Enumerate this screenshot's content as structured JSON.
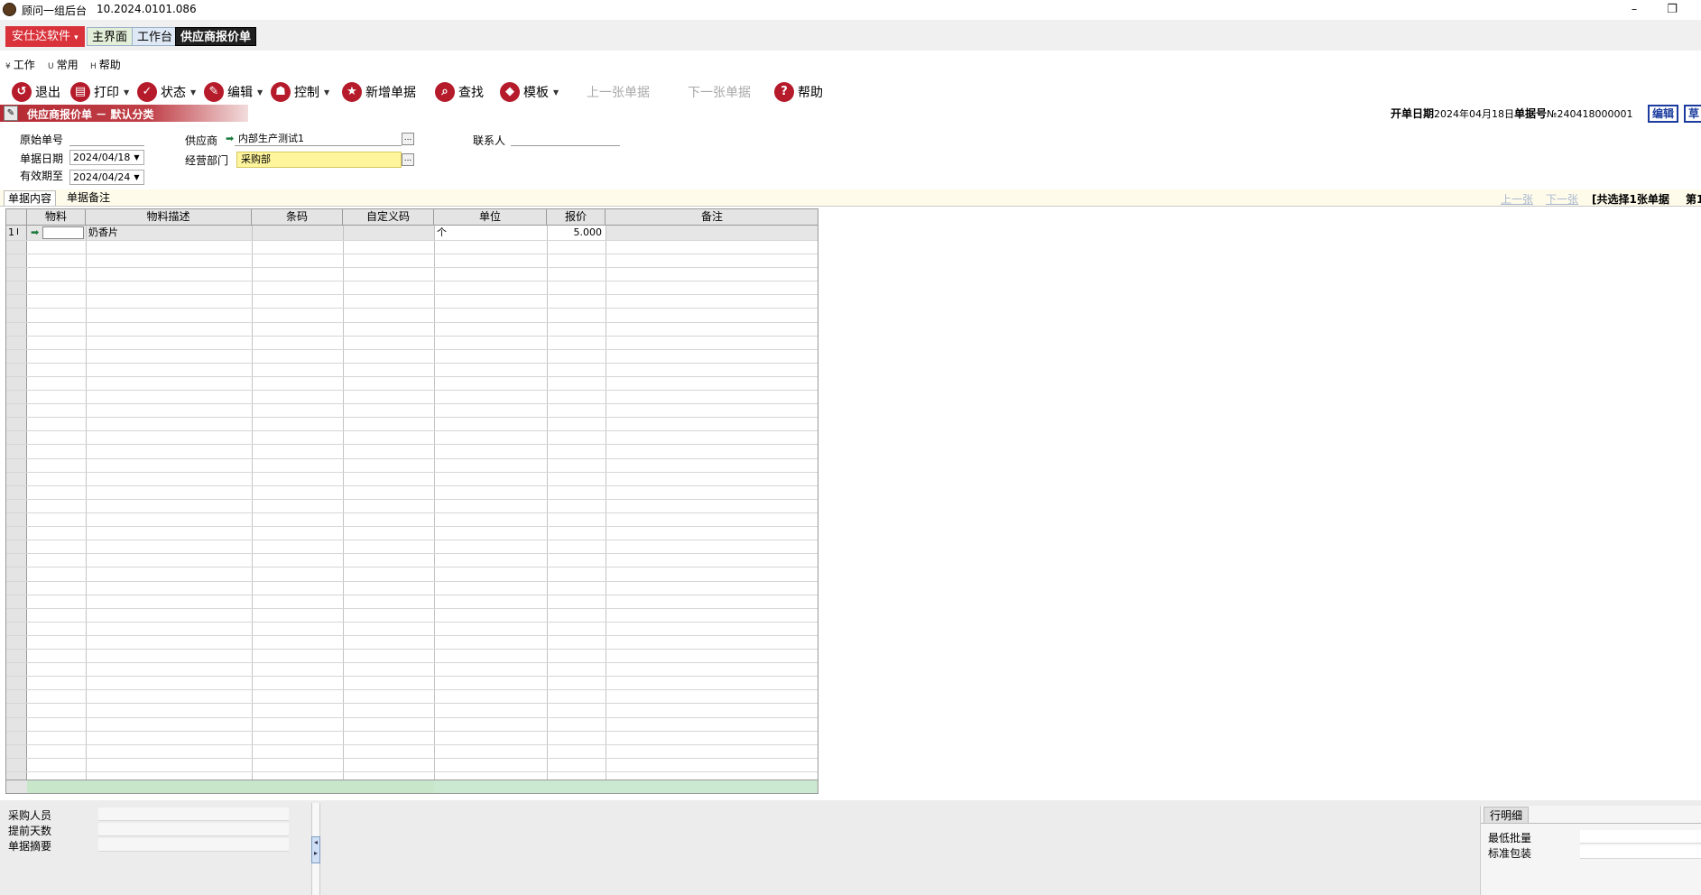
{
  "window": {
    "title": "顾问一组后台",
    "version": "10.2024.0101.086",
    "minimize_glyph": "–",
    "restore_glyph": "❐"
  },
  "tabs": {
    "brand": "安仕达软件",
    "brand_arrow": "▾",
    "home": "主界面",
    "workbench": "工作台",
    "active": "供应商报价单"
  },
  "menu": [
    {
      "key": "¥",
      "label": "工作"
    },
    {
      "key": "U",
      "label": "常用"
    },
    {
      "key": "H",
      "label": "帮助"
    }
  ],
  "toolbar": [
    {
      "label": "退出",
      "icon": "↺",
      "icon_name": "exit-icon",
      "dropdown": false,
      "enabled": true
    },
    {
      "label": "打印",
      "icon": "▤",
      "icon_name": "print-icon",
      "dropdown": true,
      "enabled": true
    },
    {
      "label": "状态",
      "icon": "✓",
      "icon_name": "check-icon",
      "dropdown": true,
      "enabled": true
    },
    {
      "label": "编辑",
      "icon": "✎",
      "icon_name": "edit-icon",
      "dropdown": true,
      "enabled": true
    },
    {
      "label": "控制",
      "icon": "☗",
      "icon_name": "user-icon",
      "dropdown": true,
      "enabled": true
    },
    {
      "label": "新增单据",
      "icon": "★",
      "icon_name": "star-icon",
      "dropdown": false,
      "enabled": true
    },
    {
      "label": "查找",
      "icon": "⌕",
      "icon_name": "search-icon",
      "dropdown": false,
      "enabled": true
    },
    {
      "label": "模板",
      "icon": "◆",
      "icon_name": "template-icon",
      "dropdown": true,
      "enabled": true
    },
    {
      "label": "上一张单据",
      "enabled": false
    },
    {
      "label": "下一张单据",
      "enabled": false
    },
    {
      "label": "帮助",
      "icon": "?",
      "icon_name": "help-icon",
      "dropdown": false,
      "enabled": true
    }
  ],
  "doc_header": {
    "strip_title": "供应商报价单 － 默认分类",
    "open_date_label": "开单日期",
    "open_date": "2024年04月18日",
    "doc_no_label": "单据号",
    "doc_no": "№240418000001",
    "side_buttons": [
      "编辑",
      "草"
    ]
  },
  "form": {
    "orig_no_label": "原始单号",
    "orig_no": "",
    "doc_date_label": "单据日期",
    "doc_date": "2024/04/18",
    "valid_until_label": "有效期至",
    "valid_until": "2024/04/24",
    "supplier_label": "供应商",
    "supplier": "内部生产测试1",
    "dept_label": "经营部门",
    "dept": "采购部",
    "contact_label": "联系人",
    "contact": "",
    "ellipsis": "..."
  },
  "subtabs": {
    "content": "单据内容",
    "note": "单据备注",
    "prev": "上一张",
    "next": "下一张",
    "selection": "[共选择1张单据",
    "page": "第1"
  },
  "grid": {
    "columns": [
      "物料",
      "物料描述",
      "条码",
      "自定义码",
      "单位",
      "报价",
      "备注"
    ],
    "rows": [
      {
        "index": "1",
        "material": "",
        "description": "奶香片",
        "barcode": "",
        "custom_code": "",
        "unit": "个",
        "price": "5.000",
        "remark": ""
      }
    ]
  },
  "bottom": {
    "fields": [
      {
        "label": "采购人员",
        "value": ""
      },
      {
        "label": "提前天数",
        "value": ""
      },
      {
        "label": "单据摘要",
        "value": ""
      }
    ],
    "detail_tab": "行明细",
    "detail_fields": [
      {
        "label": "最低批量",
        "value": ""
      },
      {
        "label": "标准包装",
        "value": ""
      }
    ]
  }
}
